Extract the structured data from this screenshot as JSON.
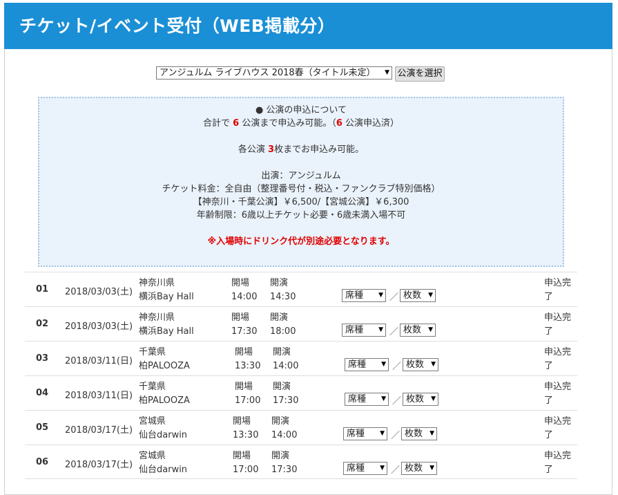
{
  "header": {
    "title": "チケット/イベント受付（WEB掲載分）"
  },
  "performance_select": {
    "value": "アンジュルム ライブハウス 2018春（タイトル未定）",
    "button_label": "公演を選択"
  },
  "info": {
    "line1": "● 公演の申込について",
    "line2_prefix": "合計で",
    "total_limit": "6",
    "line2_mid": "公演まで申込み可能。（",
    "applied_count": "6",
    "line2_suffix": "公演申込済）",
    "line3_prefix": "各公演",
    "per_show_limit": "3",
    "line3_suffix": "枚までお申込み可能。",
    "performer": "出演：アンジュルム",
    "fee": "チケット料金：全自由（整理番号付・税込・ファンクラブ特別価格）",
    "prices": "【神奈川・千葉公演】￥6,500/【宮城公演】￥6,300",
    "age": "年齢制限：6歳以上チケット必要・6歳未満入場不可",
    "warning": "※入場時にドリンク代が別途必要となります。"
  },
  "labels": {
    "open": "開場",
    "start": "開演",
    "seat": "席種",
    "qty": "枚数",
    "slash": "／"
  },
  "shows": [
    {
      "no": "01",
      "date": "2018/03/03(土)",
      "pref": "神奈川県",
      "venue": "横浜Bay Hall",
      "open": "14:00",
      "start": "14:30",
      "status": "申込完了"
    },
    {
      "no": "02",
      "date": "2018/03/03(土)",
      "pref": "神奈川県",
      "venue": "横浜Bay Hall",
      "open": "17:30",
      "start": "18:00",
      "status": "申込完了"
    },
    {
      "no": "03",
      "date": "2018/03/11(日)",
      "pref": "千葉県",
      "venue": "柏PALOOZA",
      "open": "13:30",
      "start": "14:00",
      "status": "申込完了"
    },
    {
      "no": "04",
      "date": "2018/03/11(日)",
      "pref": "千葉県",
      "venue": "柏PALOOZA",
      "open": "17:00",
      "start": "17:30",
      "status": "申込完了"
    },
    {
      "no": "05",
      "date": "2018/03/17(土)",
      "pref": "宮城県",
      "venue": "仙台darwin",
      "open": "13:30",
      "start": "14:00",
      "status": "申込完了"
    },
    {
      "no": "06",
      "date": "2018/03/17(土)",
      "pref": "宮城県",
      "venue": "仙台darwin",
      "open": "17:00",
      "start": "17:30",
      "status": "申込完了"
    }
  ]
}
